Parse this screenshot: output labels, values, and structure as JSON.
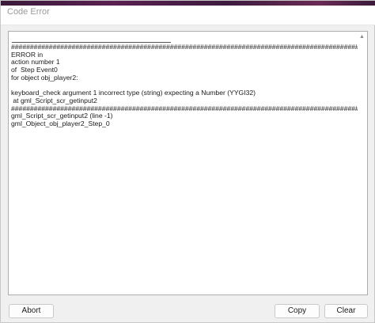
{
  "window": {
    "title": "Code Error"
  },
  "error_panel": {
    "scroll_up_glyph": "▲",
    "lines": [
      "############################################################################################",
      "ERROR in",
      "action number 1",
      "of  Step Event0",
      "for object obj_player2:",
      "",
      "keyboard_check argument 1 incorrect type (string) expecting a Number (YYGI32)",
      " at gml_Script_scr_getinput2",
      "############################################################################################",
      "gml_Script_scr_getinput2 (line -1)",
      "gml_Object_obj_player2_Step_0"
    ]
  },
  "buttons": {
    "abort": "Abort",
    "copy": "Copy",
    "clear": "Clear"
  },
  "colors": {
    "accent_strip": "#5a2050",
    "dialog_background": "#f0f0f0"
  }
}
